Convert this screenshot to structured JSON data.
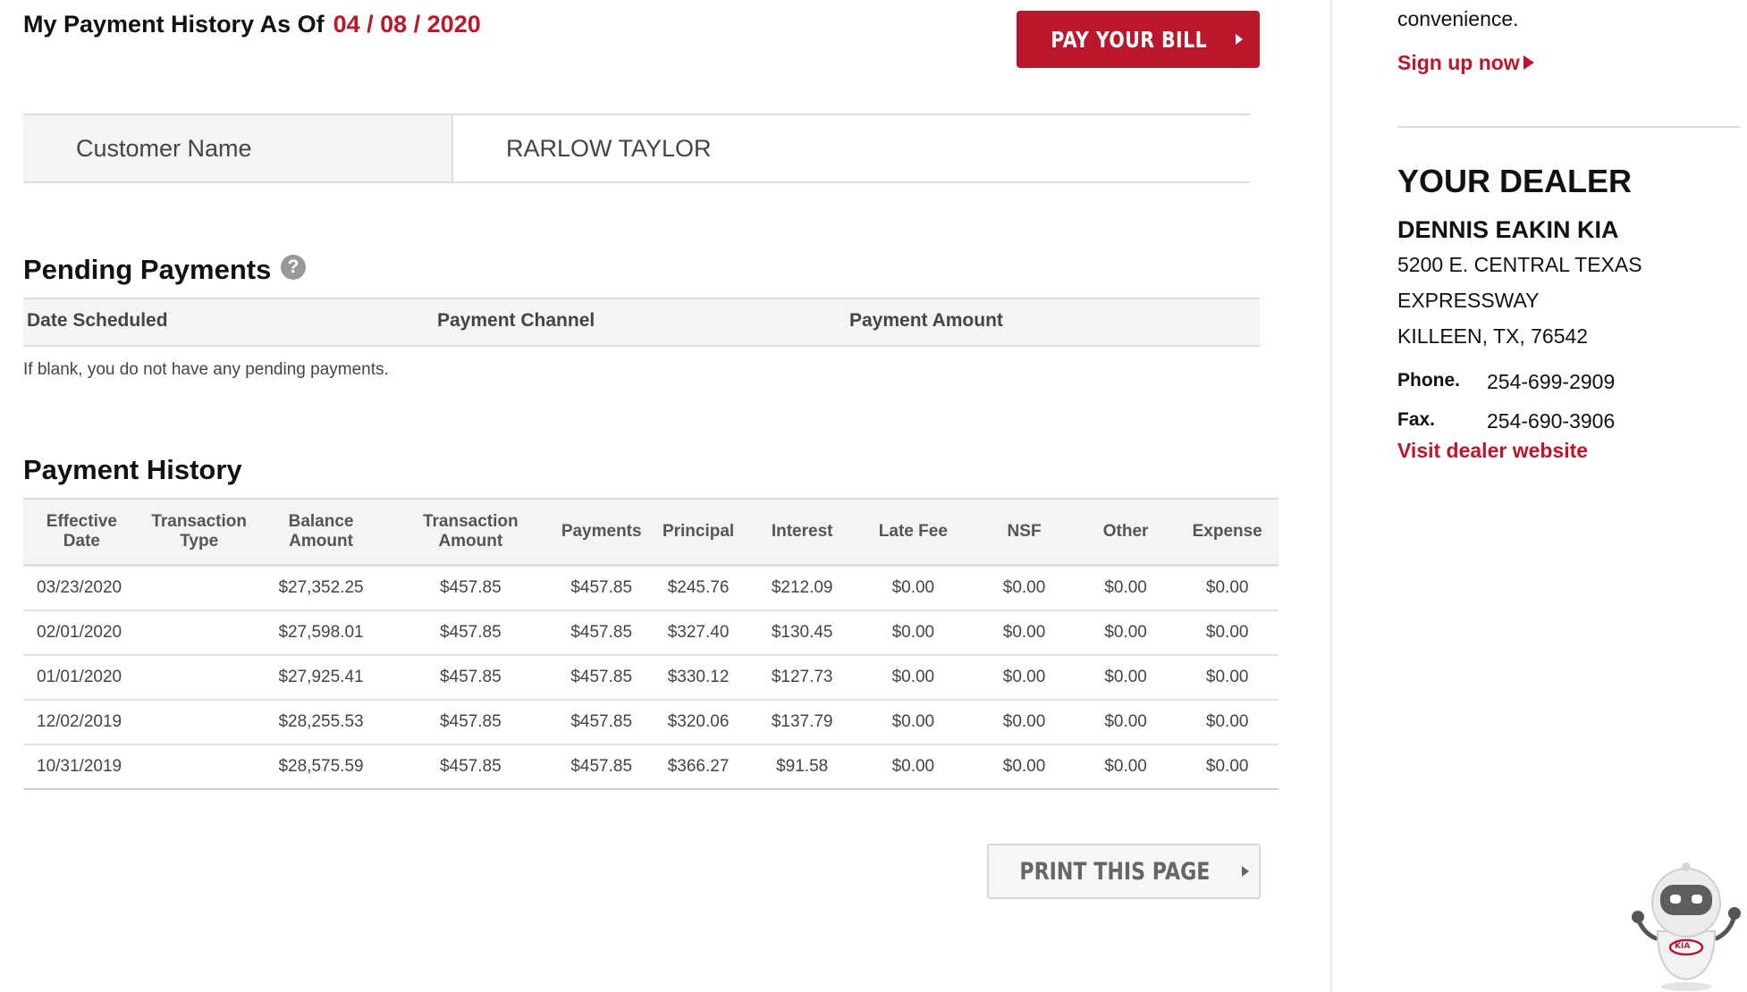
{
  "header": {
    "title": "My Payment History As Of",
    "date": "04 / 08 / 2020",
    "pay_button": "PAY YOUR BILL"
  },
  "customer": {
    "label": "Customer Name",
    "value": "RARLOW TAYLOR"
  },
  "pending": {
    "title": "Pending Payments",
    "help_icon": "question-circle-icon",
    "columns": [
      "Date Scheduled",
      "Payment Channel",
      "Payment Amount"
    ],
    "note": "If blank, you do not have any pending payments."
  },
  "history": {
    "title": "Payment History",
    "columns": [
      [
        "Effective",
        "Date"
      ],
      [
        "Transaction",
        "Type"
      ],
      [
        "Balance",
        "Amount"
      ],
      [
        "Transaction",
        "Amount"
      ],
      [
        "Payments"
      ],
      [
        "Principal"
      ],
      [
        "Interest"
      ],
      [
        "Late Fee"
      ],
      [
        "NSF"
      ],
      [
        "Other"
      ],
      [
        "Expense"
      ]
    ],
    "rows": [
      [
        "03/23/2020",
        "",
        "$27,352.25",
        "$457.85",
        "$457.85",
        "$245.76",
        "$212.09",
        "$0.00",
        "$0.00",
        "$0.00",
        "$0.00"
      ],
      [
        "02/01/2020",
        "",
        "$27,598.01",
        "$457.85",
        "$457.85",
        "$327.40",
        "$130.45",
        "$0.00",
        "$0.00",
        "$0.00",
        "$0.00"
      ],
      [
        "01/01/2020",
        "",
        "$27,925.41",
        "$457.85",
        "$457.85",
        "$330.12",
        "$127.73",
        "$0.00",
        "$0.00",
        "$0.00",
        "$0.00"
      ],
      [
        "12/02/2019",
        "",
        "$28,255.53",
        "$457.85",
        "$457.85",
        "$320.06",
        "$137.79",
        "$0.00",
        "$0.00",
        "$0.00",
        "$0.00"
      ],
      [
        "10/31/2019",
        "",
        "$28,575.59",
        "$457.85",
        "$457.85",
        "$366.27",
        "$91.58",
        "$0.00",
        "$0.00",
        "$0.00",
        "$0.00"
      ]
    ],
    "print_button": "PRINT THIS PAGE"
  },
  "sidebar": {
    "convenience_text": "convenience.",
    "signup_link": "Sign up now",
    "dealer_heading": "YOUR DEALER",
    "dealer_name": "DENNIS EAKIN KIA",
    "address_lines": [
      "5200 E. CENTRAL TEXAS",
      "EXPRESSWAY",
      "KILLEEN, TX, 76542"
    ],
    "phone_label": "Phone.",
    "phone": "254-699-2909",
    "fax_label": "Fax.",
    "fax": "254-690-3906",
    "website_link": "Visit dealer website"
  },
  "mascot": {
    "icon": "kia-robot-icon",
    "logo_text": "KIA"
  },
  "colors": {
    "accent": "#bb162b",
    "header_bg": "#f4f4f4",
    "border": "#dedede"
  }
}
